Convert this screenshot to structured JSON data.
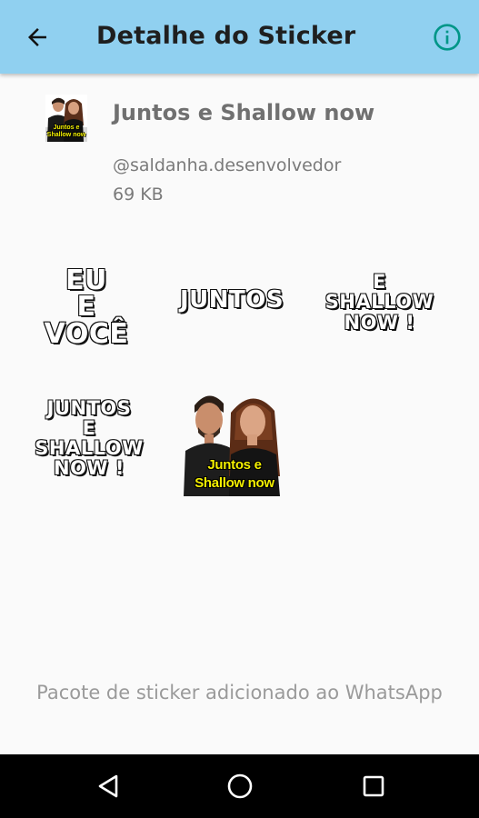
{
  "appbar": {
    "title": "Detalhe do Sticker",
    "back_icon": "arrow-left-icon",
    "info_icon": "info-icon",
    "accent": "#009688",
    "background": "#90d0f0"
  },
  "pack": {
    "title": "Juntos e Shallow now",
    "author": "@saldanha.desenvolvedor",
    "size": "69 KB",
    "thumb_caption": [
      "Juntos e",
      "Shallow now"
    ]
  },
  "stickers": [
    {
      "lines": [
        "EU",
        "E",
        "VOCÊ"
      ]
    },
    {
      "lines": [
        "JUNTOS"
      ]
    },
    {
      "lines": [
        "E",
        "SHALLOW",
        "NOW !"
      ]
    },
    {
      "lines": [
        "JUNTOS",
        "E",
        "SHALLOW",
        "NOW !"
      ]
    },
    {
      "caption": [
        "Juntos e",
        "Shallow now"
      ]
    }
  ],
  "status": "Pacote de sticker adicionado ao WhatsApp",
  "navbar": {
    "back": "triangle-back-icon",
    "home": "circle-home-icon",
    "recents": "square-recents-icon"
  }
}
